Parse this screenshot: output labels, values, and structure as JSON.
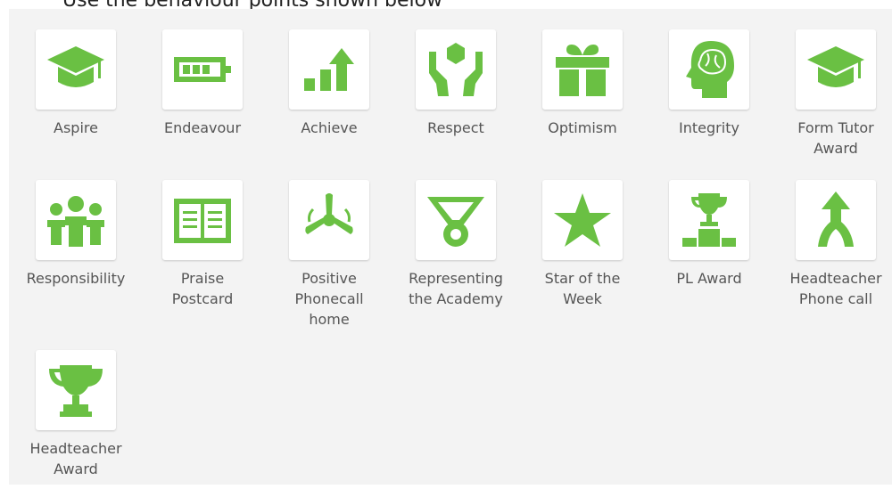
{
  "header": {
    "partial_text": "Use the behaviour points shown below"
  },
  "accent_color": "#6ac043",
  "awards": [
    {
      "label": "Aspire",
      "icon": "graduation-cap-icon"
    },
    {
      "label": "Endeavour",
      "icon": "battery-icon"
    },
    {
      "label": "Achieve",
      "icon": "growth-chart-icon"
    },
    {
      "label": "Respect",
      "icon": "hands-holding-cube-icon"
    },
    {
      "label": "Optimism",
      "icon": "gift-icon"
    },
    {
      "label": "Integrity",
      "icon": "head-brain-icon"
    },
    {
      "label": "Form Tutor\nAward",
      "icon": "graduation-cap-icon"
    },
    {
      "label": "Responsibility",
      "icon": "team-people-icon"
    },
    {
      "label": "Praise\nPostcard",
      "icon": "open-book-icon"
    },
    {
      "label": "Positive\nPhonecall\nhome",
      "icon": "wind-turbine-icon"
    },
    {
      "label": "Representing\nthe Academy",
      "icon": "medal-icon"
    },
    {
      "label": "Star of the\nWeek",
      "icon": "star-icon"
    },
    {
      "label": "PL Award",
      "icon": "trophy-podium-icon"
    },
    {
      "label": "Headteacher\nPhone call",
      "icon": "merge-arrow-icon"
    },
    {
      "label": "Headteacher\nAward",
      "icon": "trophy-icon"
    }
  ]
}
